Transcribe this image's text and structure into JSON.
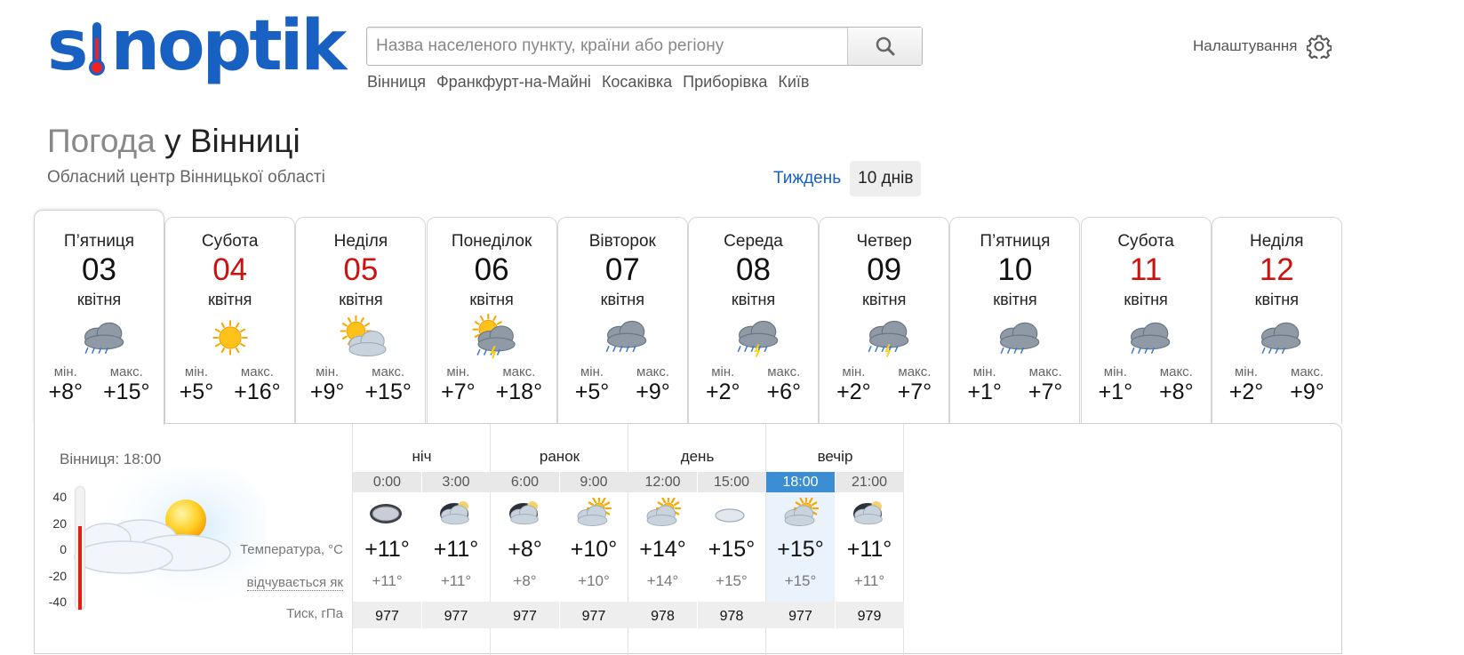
{
  "header": {
    "logo_text_1": "s",
    "logo_text_2": "noptik",
    "search_placeholder": "Назва населеного пункту, країни або регіону",
    "recent": [
      "Вінниця",
      "Франкфурт-на-Майні",
      "Косаківка",
      "Приборівка",
      "Київ"
    ],
    "settings_label": "Налаштування"
  },
  "title": {
    "prefix": "Погода",
    "city": "у Вінниці",
    "subtitle": "Обласний центр Вінницької області",
    "week": "Тиждень",
    "ten_days": "10 днів"
  },
  "days": [
    {
      "name": "П’ятниця",
      "num": "03",
      "month": "квітня",
      "min_label": "мін.",
      "max_label": "макс.",
      "min": "+8°",
      "max": "+15°",
      "weekend": false,
      "icon": "cloudy-rain-icon"
    },
    {
      "name": "Субота",
      "num": "04",
      "month": "квітня",
      "min_label": "мін.",
      "max_label": "макс.",
      "min": "+5°",
      "max": "+16°",
      "weekend": true,
      "icon": "sun-icon"
    },
    {
      "name": "Неділя",
      "num": "05",
      "month": "квітня",
      "min_label": "мін.",
      "max_label": "макс.",
      "min": "+9°",
      "max": "+15°",
      "weekend": true,
      "icon": "partly-cloudy-icon"
    },
    {
      "name": "Понеділок",
      "num": "06",
      "month": "квітня",
      "min_label": "мін.",
      "max_label": "макс.",
      "min": "+7°",
      "max": "+18°",
      "weekend": false,
      "icon": "sun-storm-icon"
    },
    {
      "name": "Вівторок",
      "num": "07",
      "month": "квітня",
      "min_label": "мін.",
      "max_label": "макс.",
      "min": "+5°",
      "max": "+9°",
      "weekend": false,
      "icon": "rain-snow-icon"
    },
    {
      "name": "Середа",
      "num": "08",
      "month": "квітня",
      "min_label": "мін.",
      "max_label": "макс.",
      "min": "+2°",
      "max": "+6°",
      "weekend": false,
      "icon": "storm-rain-icon"
    },
    {
      "name": "Четвер",
      "num": "09",
      "month": "квітня",
      "min_label": "мін.",
      "max_label": "макс.",
      "min": "+2°",
      "max": "+7°",
      "weekend": false,
      "icon": "storm-rain-icon"
    },
    {
      "name": "П’ятниця",
      "num": "10",
      "month": "квітня",
      "min_label": "мін.",
      "max_label": "макс.",
      "min": "+1°",
      "max": "+7°",
      "weekend": false,
      "icon": "cloudy-rain-icon"
    },
    {
      "name": "Субота",
      "num": "11",
      "month": "квітня",
      "min_label": "мін.",
      "max_label": "макс.",
      "min": "+1°",
      "max": "+8°",
      "weekend": true,
      "icon": "cloudy-rain-icon"
    },
    {
      "name": "Неділя",
      "num": "12",
      "month": "квітня",
      "min_label": "мін.",
      "max_label": "макс.",
      "min": "+2°",
      "max": "+9°",
      "weekend": true,
      "icon": "cloudy-rain-icon"
    }
  ],
  "detail": {
    "now_label": "Вінниця: 18:00",
    "scale": [
      "40",
      "20",
      "0",
      "-20",
      "-40"
    ],
    "thermo_level_percent": 68,
    "row_labels": {
      "temperature": "Температура, °C",
      "feels": "відчувається як",
      "pressure": "Тиск, гПа"
    },
    "groups": [
      "ніч",
      "ранок",
      "день",
      "вечір"
    ],
    "hours": [
      "0:00",
      "3:00",
      "6:00",
      "9:00",
      "12:00",
      "15:00",
      "18:00",
      "21:00"
    ],
    "current_hour_index": 6,
    "temps": [
      "+11°",
      "+11°",
      "+8°",
      "+10°",
      "+14°",
      "+15°",
      "+15°",
      "+11°"
    ],
    "feels": [
      "+11°",
      "+11°",
      "+8°",
      "+10°",
      "+14°",
      "+15°",
      "+15°",
      "+11°"
    ],
    "pressure": [
      "977",
      "977",
      "977",
      "977",
      "978",
      "978",
      "977",
      "979"
    ],
    "icons": [
      "night-cloud-icon",
      "night-cloud-moon-icon",
      "night-cloud-moon-icon",
      "sun-cloud-icon",
      "sun-cloud-icon",
      "cloud-icon",
      "sun-cloud-icon",
      "night-cloud-moon-icon"
    ]
  },
  "colors": {
    "brand": "#1960c3",
    "weekend": "#cc1111",
    "current": "#3b8ed3"
  }
}
